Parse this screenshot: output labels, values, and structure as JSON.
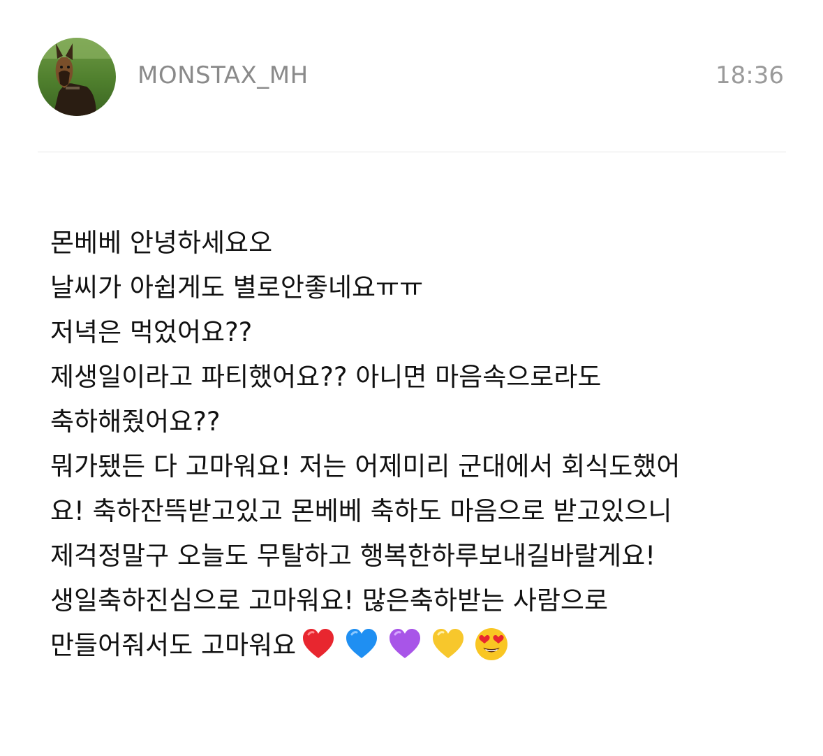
{
  "post": {
    "username": "MONSTAX_MH",
    "time": "18:36",
    "lines": [
      "몬베베 안녕하세요오",
      "날씨가 아쉽게도 별로안좋네요ㅠㅠ",
      "저녁은 먹었어요??",
      "제생일이라고 파티했어요?? 아니면 마음속으로라도",
      "축하해줬어요??",
      "뭐가됐든 다 고마워요! 저는 어제미리 군대에서 회식도했어",
      "요! 축하잔뜩받고있고 몬베베 축하도 마음으로 받고있으니",
      "제걱정말구 오늘도 무탈하고 행복한하루보내길바랄게요!",
      "생일축하진심으로 고마워요! 많은축하받는 사람으로",
      "만들어줘서도 고마워요"
    ],
    "emojis": [
      {
        "icon": "red-heart-icon",
        "color": "#e8262f"
      },
      {
        "icon": "blue-heart-icon",
        "color": "#1f8ff2"
      },
      {
        "icon": "purple-heart-icon",
        "color": "#a855e8"
      },
      {
        "icon": "yellow-heart-icon",
        "color": "#f7c72c"
      },
      {
        "icon": "heart-eyes-face-icon",
        "color": "#f9c623"
      }
    ]
  },
  "colors": {
    "username": "#8a8a8a",
    "time": "#9a9a9a",
    "text": "#111111",
    "divider": "#e6e6e6"
  }
}
